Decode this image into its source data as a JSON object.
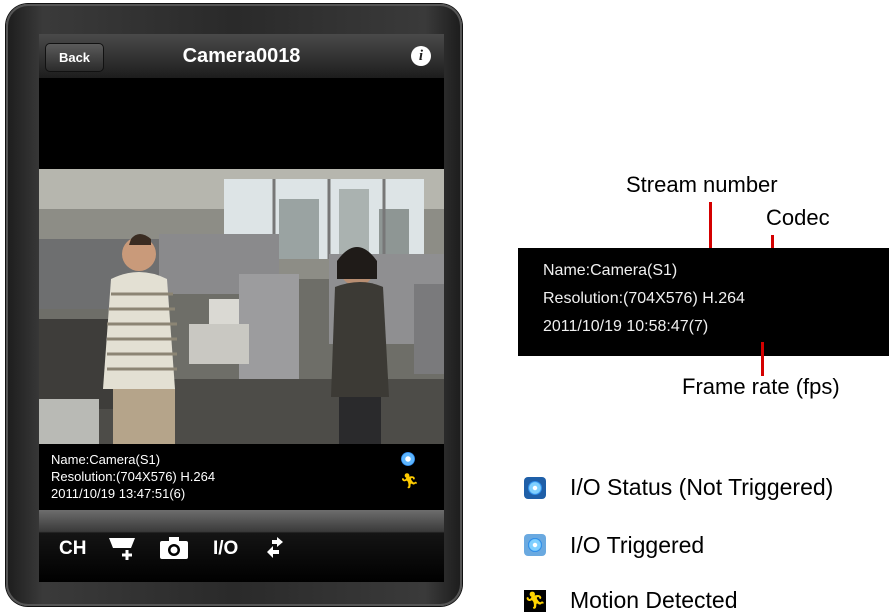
{
  "navbar": {
    "back_label": "Back",
    "title": "Camera0018",
    "info_label": "i"
  },
  "overlay": {
    "name": "Name:Camera(S1)",
    "resolution": "Resolution:(704X576) H.264",
    "timestamp": "2011/10/19 13:47:51(6)",
    "io_icon": "io-status-icon",
    "motion_icon": "motion-detected-icon"
  },
  "toolbar": {
    "ch_label": "CH",
    "ptz_icon": "ptz-icon",
    "snapshot_icon": "camera-icon",
    "io_label": "I/O",
    "switch_icon": "switch-arrows-icon"
  },
  "callouts": {
    "stream_number": "Stream number",
    "codec": "Codec",
    "frame_rate": "Frame rate (fps)"
  },
  "info_box": {
    "name": "Name:Camera(S1)",
    "resolution": "Resolution:(704X576) H.264",
    "timestamp": "2011/10/19 10:58:47(7)"
  },
  "legend": [
    {
      "label": "I/O Status (Not Triggered)",
      "icon": "io-not-triggered-icon"
    },
    {
      "label": "I/O Triggered",
      "icon": "io-triggered-icon"
    },
    {
      "label": "Motion Detected",
      "icon": "motion-detected-icon"
    }
  ],
  "colors": {
    "accent_red": "#d40000",
    "io_blue": "#1e5fa8",
    "motion_yellow": "#ffd400"
  }
}
